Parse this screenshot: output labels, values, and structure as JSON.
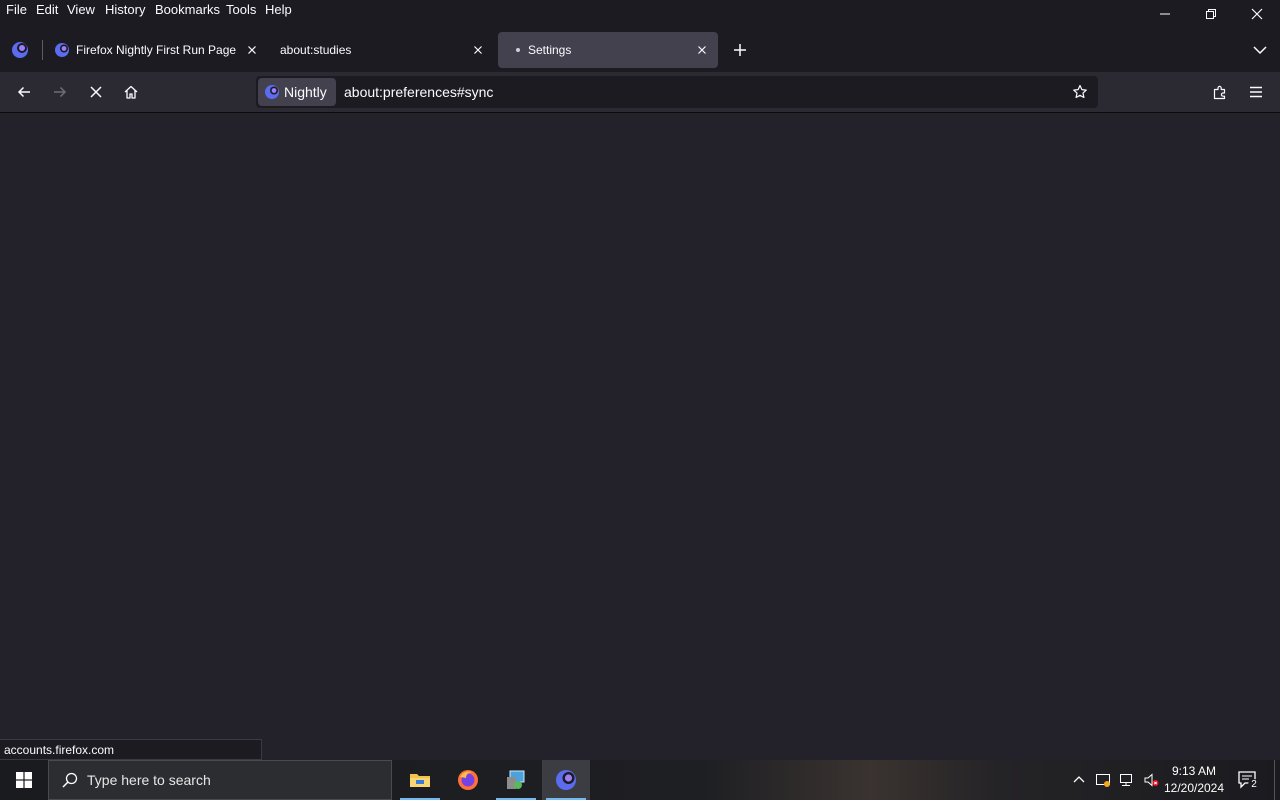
{
  "menubar": {
    "items": [
      "File",
      "Edit",
      "View",
      "History",
      "Bookmarks",
      "Tools",
      "Help"
    ]
  },
  "tabs": [
    {
      "label": "Firefox Nightly First Run Page",
      "favicon": "nightly-icon",
      "active": false
    },
    {
      "label": "about:studies",
      "favicon": "none",
      "active": false
    },
    {
      "label": "Settings",
      "favicon": "dot",
      "active": true
    }
  ],
  "navbar": {
    "identity_label": "Nightly",
    "url": "about:preferences#sync"
  },
  "status": {
    "link": "accounts.firefox.com"
  },
  "taskbar": {
    "search_placeholder": "Type here to search",
    "apps": [
      "file-explorer-icon",
      "firefox-icon",
      "control-panel-icon",
      "firefox-nightly-icon"
    ],
    "clock_time": "9:13 AM",
    "clock_date": "12/20/2024",
    "notification_count": "2"
  },
  "colors": {
    "chrome_bg": "#1c1b22",
    "toolbar_bg": "#2b2a33",
    "content_bg": "#23222b",
    "active_tab": "#42414d",
    "accent": "#76b9ed"
  }
}
